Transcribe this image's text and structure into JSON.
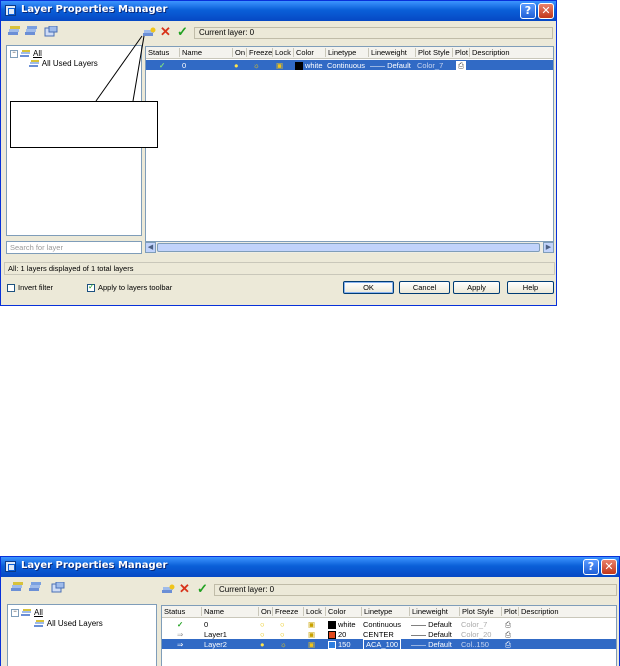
{
  "window1": {
    "title": "Layer Properties Manager",
    "current_layer": "Current layer: 0",
    "tree": {
      "root": "All",
      "child": "All Used Layers"
    },
    "search_placeholder": "Search for layer",
    "columns": [
      "Status",
      "Name",
      "On",
      "Freeze",
      "Lock",
      "Color",
      "Linetype",
      "Lineweight",
      "Plot Style",
      "Plot",
      "Description"
    ],
    "rows": [
      {
        "name": "0",
        "color_name": "white",
        "color_hex": "#000000",
        "linetype": "Continuous",
        "lineweight": "—— Default",
        "plot_style": "Color_7",
        "selected": true
      }
    ],
    "status_text": "All: 1 layers displayed of 1 total layers",
    "invert_filter": "Invert filter",
    "apply_toolbar": "Apply to layers toolbar",
    "buttons": {
      "ok": "OK",
      "cancel": "Cancel",
      "apply": "Apply",
      "help": "Help"
    }
  },
  "window2": {
    "title": "Layer Properties Manager",
    "current_layer": "Current layer: 0",
    "tree": {
      "root": "All",
      "child": "All Used Layers"
    },
    "columns": [
      "Status",
      "Name",
      "On",
      "Freeze",
      "Lock",
      "Color",
      "Linetype",
      "Lineweight",
      "Plot Style",
      "Plot",
      "Description"
    ],
    "rows": [
      {
        "name": "0",
        "color_name": "white",
        "color_hex": "#000000",
        "linetype": "Continuous",
        "lineweight": "—— Default",
        "plot_style": "Color_7",
        "selected": false
      },
      {
        "name": "Layer1",
        "color_name": "20",
        "color_hex": "#e0481c",
        "linetype": "CENTER",
        "lineweight": "—— Default",
        "plot_style": "Color_20",
        "selected": false
      },
      {
        "name": "Layer2",
        "color_name": "150",
        "color_hex": "#2f7fe0",
        "linetype": "ACA_100",
        "lineweight": "—— Default",
        "plot_style": "Col..150",
        "selected": true
      }
    ]
  },
  "colors": {
    "titlebar": "#0a5fd8",
    "selection": "#316ac5",
    "dialog_bg": "#ece9d8",
    "check_green": "#21a121",
    "delete_red": "#d8331a"
  },
  "icons": [
    "new-properties-filter-icon",
    "new-group-filter-icon",
    "layer-states-icon",
    "new-layer-icon",
    "delete-layer-icon",
    "set-current-icon",
    "help-icon",
    "close-icon"
  ]
}
